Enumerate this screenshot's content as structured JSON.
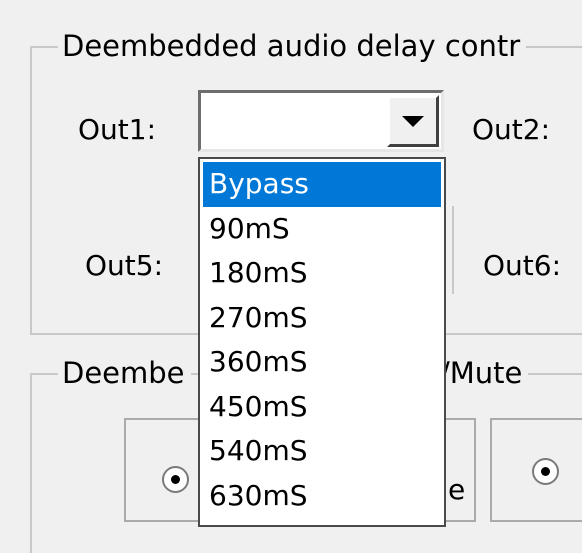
{
  "delay_group": {
    "title": "Deembedded audio delay contr",
    "out1_label": "Out1:",
    "out2_label": "Out2:",
    "out5_label": "Out5:",
    "out6_label": "Out6:",
    "out1_value": ""
  },
  "mute_group": {
    "title_left": "Deembe",
    "title_right": "/Mute",
    "option_fragment": "e"
  },
  "dropdown": {
    "selected_index": 0,
    "items": [
      "Bypass",
      "90mS",
      "180mS",
      "270mS",
      "360mS",
      "450mS",
      "540mS",
      "630mS"
    ]
  },
  "icons": {
    "combo_arrow": "chevron-down-icon",
    "radio": "radio-selected-icon"
  },
  "colors": {
    "selection": "#0078d7",
    "window_bg": "#f0f0f0"
  }
}
